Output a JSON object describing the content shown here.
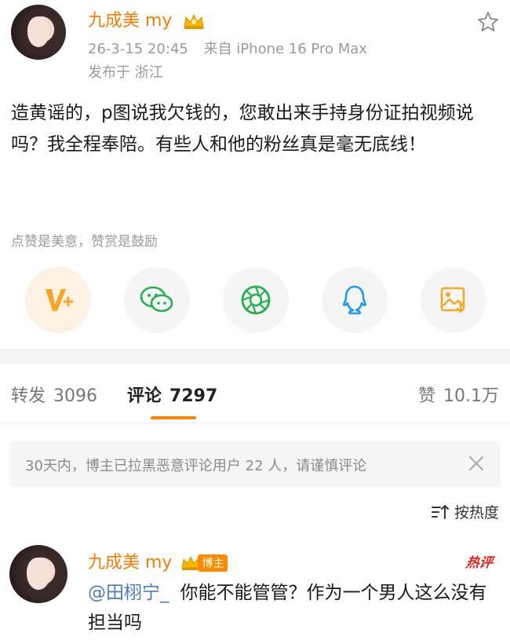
{
  "post": {
    "username": "九成美 my",
    "date": "26-3-15 20:45",
    "device": "来自 iPhone 16 Pro Max",
    "location": "发布于 浙江",
    "body": "造黄谣的，p图说我欠钱的，您敢出来手持身份证拍视频说吗？我全程奉陪。有些人和他的粉丝真是毫无底线！"
  },
  "reward": {
    "text": "点赞是美意，赞赏是鼓励"
  },
  "share": {
    "items": [
      {
        "icon": "v-plus-icon"
      },
      {
        "icon": "wechat-icon"
      },
      {
        "icon": "moments-icon"
      },
      {
        "icon": "qq-icon"
      },
      {
        "icon": "save-image-icon"
      }
    ]
  },
  "tabs": {
    "repost_label": "转发",
    "repost_count": "3096",
    "comment_label": "评论",
    "comment_count": "7297",
    "like_label": "赞",
    "like_count": "10.1万"
  },
  "notice": {
    "text": "30天内，博主已拉黑恶意评论用户 22 人，请谨慎评论"
  },
  "sort": {
    "label": "按热度"
  },
  "comment": {
    "username": "九成美 my",
    "badge": "博主",
    "hot_tag": "热评",
    "mention": "@田栩宁_",
    "text": "你能不能管管？作为一个男人这么没有担当吗"
  },
  "colors": {
    "accent": "#ff8200",
    "username": "#f57c00",
    "mention": "#4e7bbf",
    "hot": "#e2231a"
  }
}
